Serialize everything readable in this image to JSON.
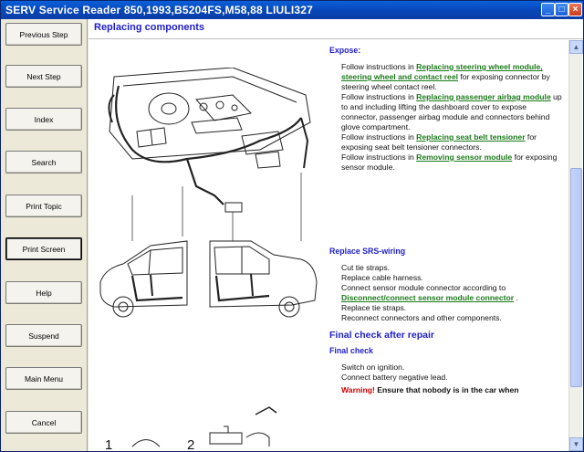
{
  "window": {
    "title": "SERV Service Reader 850,1993,B5204FS,M58,88 LIULI327",
    "min_glyph": "_",
    "max_glyph": "□",
    "close_glyph": "×"
  },
  "sidebar": {
    "items": [
      {
        "label": "Previous Step"
      },
      {
        "label": "Next Step"
      },
      {
        "label": "Index"
      },
      {
        "label": "Search"
      },
      {
        "label": "Print Topic"
      },
      {
        "label": "Print Screen"
      },
      {
        "label": "Help"
      },
      {
        "label": "Suspend"
      },
      {
        "label": "Main Menu"
      },
      {
        "label": "Cancel"
      }
    ]
  },
  "page": {
    "title": "Replacing components"
  },
  "figure": {
    "label_1": "1",
    "label_2": "2"
  },
  "content": {
    "expose_title": "Expose:",
    "expose_p1_a": "Follow instructions in ",
    "expose_p1_link": "Replacing steering wheel module, steering wheel and contact reel",
    "expose_p1_b": " for exposing connector by steering wheel contact reel.",
    "expose_p2_a": "Follow instructions in ",
    "expose_p2_link": "Replacing passenger airbag module",
    "expose_p2_b": " up to and including lifting the dashboard cover to expose connector, passenger airbag module and connectors behind glove compartment.",
    "expose_p3_a": "Follow instructions in ",
    "expose_p3_link": "Replacing seat belt tensioner",
    "expose_p3_b": " for exposing seat belt tensioner connectors.",
    "expose_p4_a": "Follow instructions in ",
    "expose_p4_link": "Removing sensor module",
    "expose_p4_b": " for exposing sensor module.",
    "replace_title": "Replace SRS-wiring",
    "replace_l1": "Cut tie straps.",
    "replace_l2": "Replace cable harness.",
    "replace_l3": "Connect sensor module connector according to",
    "replace_link": "Disconnect/connect sensor module connector",
    "replace_l3_end": " .",
    "replace_l4": "Replace tie straps.",
    "replace_l5": "Reconnect connectors and other components.",
    "final_heading": "Final check after repair",
    "final_title": "Final check",
    "final_l1": "Switch on ignition.",
    "final_l2": "Connect battery negative lead.",
    "warning_label": "Warning!",
    "warning_text": " Ensure that nobody is in the car when"
  },
  "scrollbar": {
    "up_glyph": "▲",
    "down_glyph": "▼"
  }
}
